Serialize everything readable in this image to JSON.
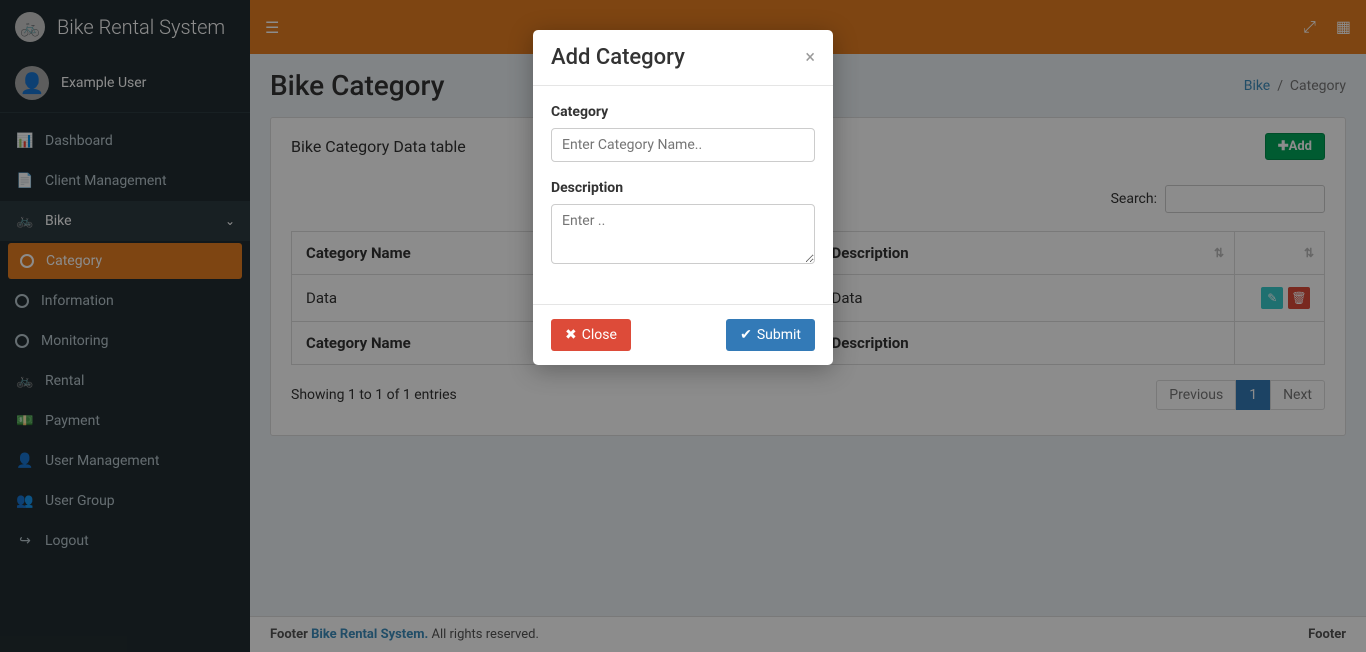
{
  "brand": {
    "title": "Bike Rental System"
  },
  "user": {
    "name": "Example User"
  },
  "sidebar": {
    "items": [
      {
        "label": "Dashboard"
      },
      {
        "label": "Client Management"
      },
      {
        "label": "Bike"
      },
      {
        "label": "Category"
      },
      {
        "label": "Information"
      },
      {
        "label": "Monitoring"
      },
      {
        "label": "Rental"
      },
      {
        "label": "Payment"
      },
      {
        "label": "User Management"
      },
      {
        "label": "User Group"
      },
      {
        "label": "Logout"
      }
    ]
  },
  "topbar": {},
  "page": {
    "title": "Bike Category",
    "breadcrumb": {
      "link": "Bike",
      "sep": "/",
      "current": "Category"
    }
  },
  "panel": {
    "title": "Bike Category Data table",
    "addLabel": "Add",
    "searchLabel": "Search:",
    "columns": {
      "c1": "Category Name",
      "c2": "Description"
    },
    "rows": [
      {
        "name": "Data",
        "desc": "Data"
      }
    ],
    "footerCols": {
      "c1": "Category Name",
      "c2": "Description"
    },
    "info": "Showing 1 to 1 of 1 entries",
    "pagination": {
      "prev": "Previous",
      "page": "1",
      "next": "Next"
    }
  },
  "footer": {
    "leftPrefix": "Footer",
    "brandLink": "Bike Rental System.",
    "rights": "All rights reserved.",
    "right": "Footer"
  },
  "modal": {
    "title": "Add Category",
    "fields": {
      "category": {
        "label": "Category",
        "placeholder": "Enter Category Name.."
      },
      "description": {
        "label": "Description",
        "placeholder": "Enter .."
      }
    },
    "buttons": {
      "close": "Close",
      "submit": "Submit"
    }
  }
}
